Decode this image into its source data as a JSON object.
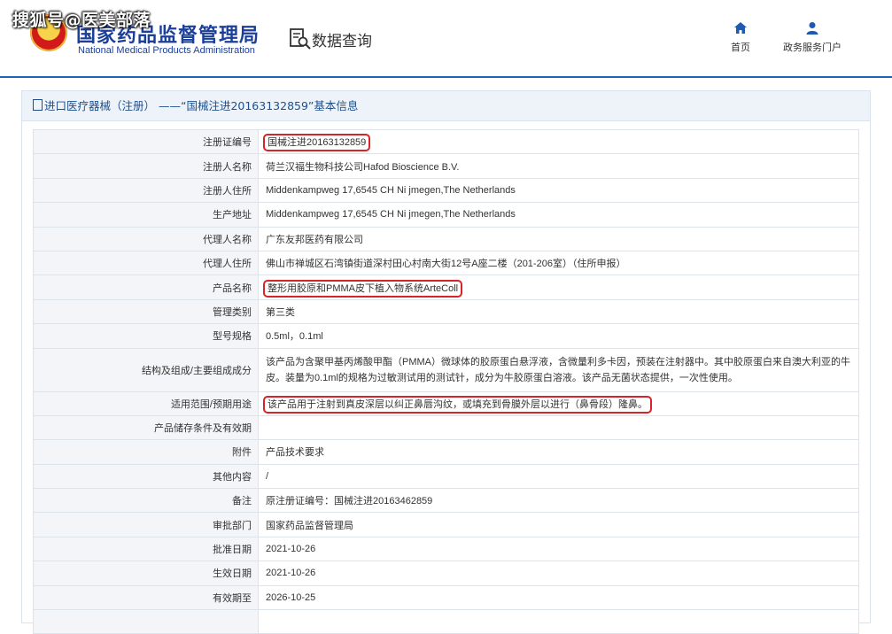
{
  "watermark": "搜狐号@医美部落",
  "header": {
    "agency_cn": "国家药品监督管理局",
    "agency_en": "National Medical Products Administration",
    "query_title": "数据查询",
    "nav": [
      {
        "label": "首页",
        "icon": "home-icon"
      },
      {
        "label": "政务服务门户",
        "icon": "user-icon"
      }
    ]
  },
  "panel": {
    "title": "进口医疗器械（注册） ——“国械注进20163132859”基本信息"
  },
  "rows": [
    {
      "label": "注册证编号",
      "value": "国械注进20163132859",
      "highlight": true
    },
    {
      "label": "注册人名称",
      "value": "荷兰汉福生物科技公司Hafod Bioscience B.V."
    },
    {
      "label": "注册人住所",
      "value": "Middenkampweg 17,6545 CH Ni jmegen,The Netherlands"
    },
    {
      "label": "生产地址",
      "value": "Middenkampweg 17,6545 CH Ni jmegen,The Netherlands"
    },
    {
      "label": "代理人名称",
      "value": "广东友邦医药有限公司"
    },
    {
      "label": "代理人住所",
      "value": "佛山市禅城区石湾镇街道深村田心村南大街12号A座二楼（201-206室）（住所申报）"
    },
    {
      "label": "产品名称",
      "value": "整形用胶原和PMMA皮下植入物系统ArteColl",
      "highlight": true
    },
    {
      "label": "管理类别",
      "value": "第三类"
    },
    {
      "label": "型号规格",
      "value": "0.5ml，0.1ml"
    },
    {
      "label": "结构及组成/主要组成成分",
      "value": "该产品为含聚甲基丙烯酸甲酯（PMMA）微球体的胶原蛋白悬浮液，含微量利多卡因，预装在注射器中。其中胶原蛋白来自澳大利亚的牛皮。装量为0.1ml的规格为过敏测试用的测试针，成分为牛胶原蛋白溶液。该产品无菌状态提供，一次性使用。"
    },
    {
      "label": "适用范围/预期用途",
      "value": "该产品用于注射到真皮深层以纠正鼻唇沟纹，或填充到骨膜外层以进行（鼻骨段）隆鼻。",
      "highlight": true
    },
    {
      "label": "产品储存条件及有效期",
      "value": ""
    },
    {
      "label": "附件",
      "value": "产品技术要求"
    },
    {
      "label": "其他内容",
      "value": "/"
    },
    {
      "label": "备注",
      "value": "原注册证编号：国械注进20163462859"
    },
    {
      "label": "审批部门",
      "value": "国家药品监督管理局"
    },
    {
      "label": "批准日期",
      "value": "2021-10-26"
    },
    {
      "label": "生效日期",
      "value": "2021-10-26"
    },
    {
      "label": "有效期至",
      "value": "2026-10-25"
    },
    {
      "label": "",
      "value": ""
    }
  ]
}
